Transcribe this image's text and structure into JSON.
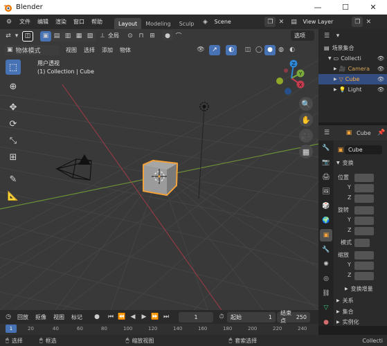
{
  "window": {
    "app_title": "Blender",
    "minimize": "—",
    "maximize": "☐",
    "close": "✕"
  },
  "topbar": {
    "menus": [
      "文件",
      "编辑",
      "渲染",
      "窗口",
      "帮助"
    ],
    "tabs": [
      {
        "label": "Layout",
        "active": true
      },
      {
        "label": "Modeling",
        "active": false
      },
      {
        "label": "Sculp",
        "active": false
      }
    ],
    "scene": "Scene",
    "view_layer": "View Layer"
  },
  "toolbar_row": {
    "orientation": "全局",
    "options": "选项"
  },
  "viewport": {
    "mode": "物体模式",
    "menus": [
      "视图",
      "选择",
      "添加",
      "物体"
    ],
    "overlay_title": "用户透视",
    "overlay_collection": "(1) Collection | Cube",
    "gizmo": {
      "x": "X",
      "y": "Y",
      "z": "Z"
    }
  },
  "outliner": {
    "root": "场景集合",
    "items": [
      {
        "label": "Collecti",
        "selected": false
      },
      {
        "label": "Camera",
        "selected": false
      },
      {
        "label": "Cube",
        "selected": true
      },
      {
        "label": "Light",
        "selected": false
      }
    ]
  },
  "properties": {
    "object_name": "Cube",
    "name_field": "Cube",
    "section_transform": "变换",
    "location": "位置",
    "rotation": "旋转",
    "mode_label": "模式",
    "scale": "缩放",
    "axis": [
      "Y",
      "Z"
    ],
    "delta": "变换增量",
    "relations": "关系",
    "collections": "集合",
    "instancing": "实例化"
  },
  "timeline": {
    "menus": [
      "回放",
      "抠像",
      "视图",
      "标记"
    ],
    "current_frame": "1",
    "start_label": "起始",
    "start": "1",
    "end_label": "结束点",
    "end": "250",
    "ruler": [
      "20",
      "40",
      "60",
      "80",
      "100",
      "120",
      "140",
      "160",
      "180",
      "200",
      "220",
      "240"
    ]
  },
  "status": {
    "select": "选择",
    "box": "框选",
    "zoom": "缩放视图",
    "lasso": "套索选择",
    "right": "Collecti"
  },
  "colors": {
    "accent": "#4772b3",
    "selection_orange": "#f2a23b",
    "x_axis": "#c43c4e",
    "y_axis": "#7aab3c",
    "z_axis": "#2f86d6"
  }
}
